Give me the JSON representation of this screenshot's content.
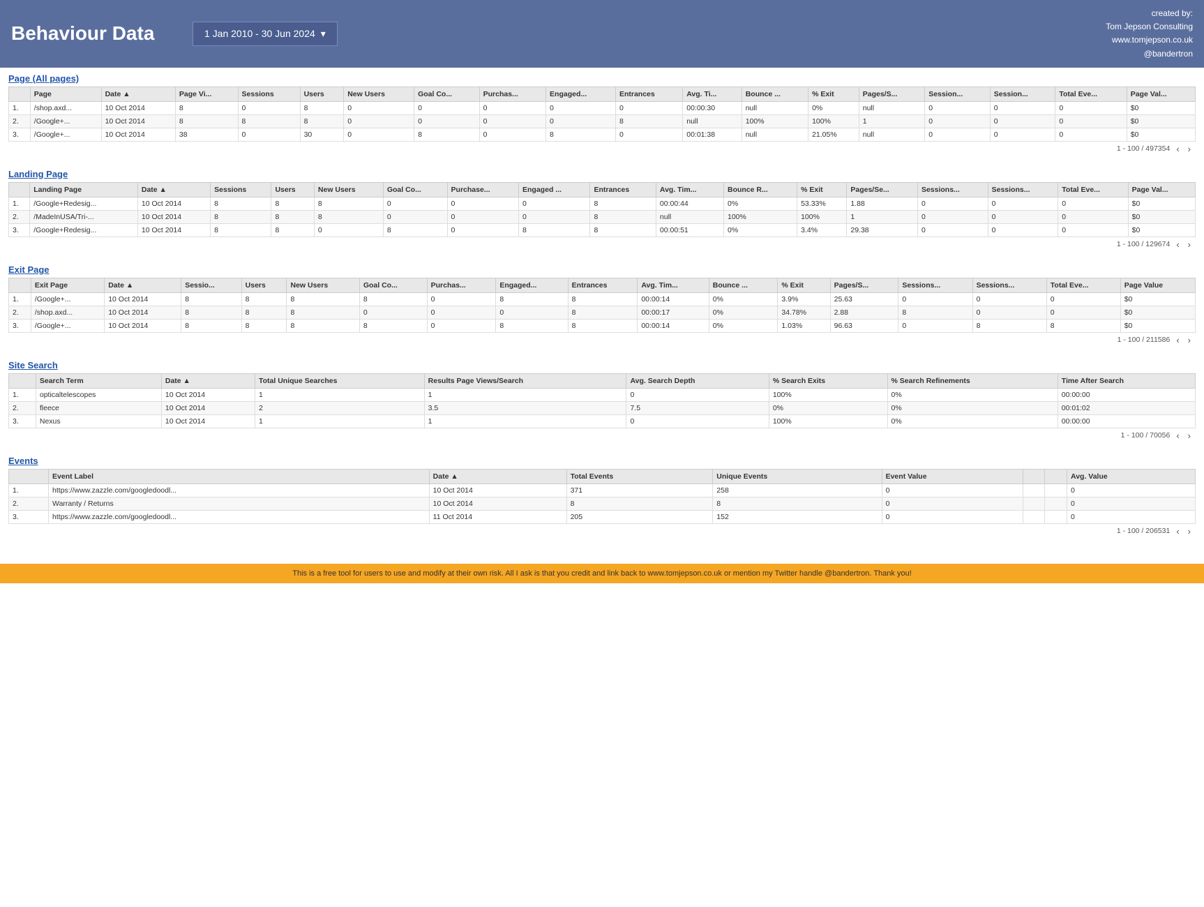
{
  "header": {
    "title": "Behaviour Data",
    "date_range": "1 Jan 2010 - 30 Jun 2024",
    "arrow": "▾",
    "credit_line1": "created by:",
    "credit_line2": "Tom Jepson Consulting",
    "credit_line3": "www.tomjepson.co.uk",
    "credit_line4": "@bandertron"
  },
  "sections": {
    "page": {
      "title": "Page (All pages)",
      "columns": [
        "",
        "Page",
        "Date ▲",
        "Page Vi...",
        "Sessions",
        "Users",
        "New Users",
        "Goal Co...",
        "Purchas...",
        "Engaged...",
        "Entrances",
        "Avg. Ti...",
        "Bounce ...",
        "% Exit",
        "Pages/S...",
        "Session...",
        "Session...",
        "Total Eve...",
        "Page Val..."
      ],
      "rows": [
        [
          "1.",
          "/shop.axd...",
          "10 Oct 2014",
          "8",
          "0",
          "8",
          "0",
          "0",
          "0",
          "0",
          "0",
          "00:00:30",
          "null",
          "0%",
          "null",
          "0",
          "0",
          "0",
          "$0"
        ],
        [
          "2.",
          "/Google+...",
          "10 Oct 2014",
          "8",
          "8",
          "8",
          "0",
          "0",
          "0",
          "0",
          "8",
          "null",
          "100%",
          "100%",
          "1",
          "0",
          "0",
          "0",
          "$0"
        ],
        [
          "3.",
          "/Google+...",
          "10 Oct 2014",
          "38",
          "0",
          "30",
          "0",
          "8",
          "0",
          "8",
          "0",
          "00:01:38",
          "null",
          "21.05%",
          "null",
          "0",
          "0",
          "0",
          "$0"
        ]
      ],
      "pagination": "1 - 100 / 497354"
    },
    "landing": {
      "title": "Landing Page",
      "columns": [
        "",
        "Landing Page",
        "Date ▲",
        "Sessions",
        "Users",
        "New Users",
        "Goal Co...",
        "Purchase...",
        "Engaged ...",
        "Entrances",
        "Avg. Tim...",
        "Bounce R...",
        "% Exit",
        "Pages/Se...",
        "Sessions...",
        "Sessions...",
        "Total Eve...",
        "Page Val..."
      ],
      "rows": [
        [
          "1.",
          "/Google+Redesig...",
          "10 Oct 2014",
          "8",
          "8",
          "8",
          "0",
          "0",
          "0",
          "8",
          "00:00:44",
          "0%",
          "53.33%",
          "1.88",
          "0",
          "0",
          "0",
          "$0"
        ],
        [
          "2.",
          "/MadeInUSA/Tri-...",
          "10 Oct 2014",
          "8",
          "8",
          "8",
          "0",
          "0",
          "0",
          "8",
          "null",
          "100%",
          "100%",
          "1",
          "0",
          "0",
          "0",
          "$0"
        ],
        [
          "3.",
          "/Google+Redesig...",
          "10 Oct 2014",
          "8",
          "8",
          "0",
          "8",
          "0",
          "8",
          "8",
          "00:00:51",
          "0%",
          "3.4%",
          "29.38",
          "0",
          "0",
          "0",
          "$0"
        ]
      ],
      "pagination": "1 - 100 / 129674"
    },
    "exit": {
      "title": "Exit Page",
      "columns": [
        "",
        "Exit Page",
        "Date ▲",
        "Sessio...",
        "Users",
        "New Users",
        "Goal Co...",
        "Purchas...",
        "Engaged...",
        "Entrances",
        "Avg. Tim...",
        "Bounce ...",
        "% Exit",
        "Pages/S...",
        "Sessions...",
        "Sessions...",
        "Total Eve...",
        "Page Value"
      ],
      "rows": [
        [
          "1.",
          "/Google+...",
          "10 Oct 2014",
          "8",
          "8",
          "8",
          "8",
          "0",
          "8",
          "8",
          "00:00:14",
          "0%",
          "3.9%",
          "25.63",
          "0",
          "0",
          "0",
          "$0"
        ],
        [
          "2.",
          "/shop.axd...",
          "10 Oct 2014",
          "8",
          "8",
          "8",
          "0",
          "0",
          "0",
          "8",
          "00:00:17",
          "0%",
          "34.78%",
          "2.88",
          "8",
          "0",
          "0",
          "$0"
        ],
        [
          "3.",
          "/Google+...",
          "10 Oct 2014",
          "8",
          "8",
          "8",
          "8",
          "0",
          "8",
          "8",
          "00:00:14",
          "0%",
          "1.03%",
          "96.63",
          "0",
          "8",
          "8",
          "$0"
        ]
      ],
      "pagination": "1 - 100 / 211586"
    },
    "site_search": {
      "title": "Site Search",
      "columns": [
        "",
        "Search Term",
        "Date ▲",
        "Total Unique Searches",
        "Results Page Views/Search",
        "Avg. Search Depth",
        "% Search Exits",
        "% Search Refinements",
        "Time After Search"
      ],
      "rows": [
        [
          "1.",
          "opticaltelescopes",
          "10 Oct 2014",
          "1",
          "1",
          "0",
          "100%",
          "0%",
          "00:00:00"
        ],
        [
          "2.",
          "fleece",
          "10 Oct 2014",
          "2",
          "3.5",
          "7.5",
          "0%",
          "0%",
          "00:01:02"
        ],
        [
          "3.",
          "Nexus",
          "10 Oct 2014",
          "1",
          "1",
          "0",
          "100%",
          "0%",
          "00:00:00"
        ]
      ],
      "pagination": "1 - 100 / 70056"
    },
    "events": {
      "title": "Events",
      "columns": [
        "",
        "Event Label",
        "Date ▲",
        "Total Events",
        "Unique Events",
        "Event Value",
        "",
        "",
        "Avg. Value"
      ],
      "rows": [
        [
          "1.",
          "https://www.zazzle.com/googledoodl...",
          "10 Oct 2014",
          "371",
          "258",
          "0",
          "",
          "",
          "0"
        ],
        [
          "2.",
          "Warranty / Returns",
          "10 Oct 2014",
          "8",
          "8",
          "0",
          "",
          "",
          "0"
        ],
        [
          "3.",
          "https://www.zazzle.com/googledoodl...",
          "11 Oct 2014",
          "205",
          "152",
          "0",
          "",
          "",
          "0"
        ]
      ],
      "pagination": "1 - 100 / 206531"
    }
  },
  "footer": {
    "text": "This is a free tool for users to use and modify at their own risk. All I ask is that you credit and link back to www.tomjepson.co.uk or mention my Twitter handle @bandertron. Thank you!"
  },
  "pagination": {
    "prev": "‹",
    "next": "›"
  }
}
